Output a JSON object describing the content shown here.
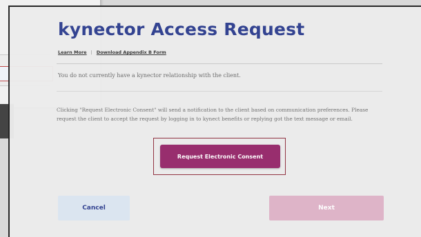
{
  "modal": {
    "title": "kynector Access Request",
    "links": {
      "learn_more": "Learn More",
      "separator": "|",
      "download": "Download Appendix B Form"
    },
    "status_text": "You do not currently have a kynector relationship with the client.",
    "info_text": "Clicking \"Request Electronic Consent\" will send a notification to the client based on communication preferences. Please request the client to accept the request by logging in to kynect benefits or replying got the text message or email.",
    "buttons": {
      "request_consent": "Request Electronic Consent",
      "cancel": "Cancel",
      "next": "Next"
    }
  },
  "colors": {
    "title": "#2e3f8f",
    "primary_button": "#96296b",
    "cancel_button_bg": "#dce6f1",
    "next_button_disabled": "#dfb3c8",
    "highlight_frame": "#8f2e3e"
  }
}
